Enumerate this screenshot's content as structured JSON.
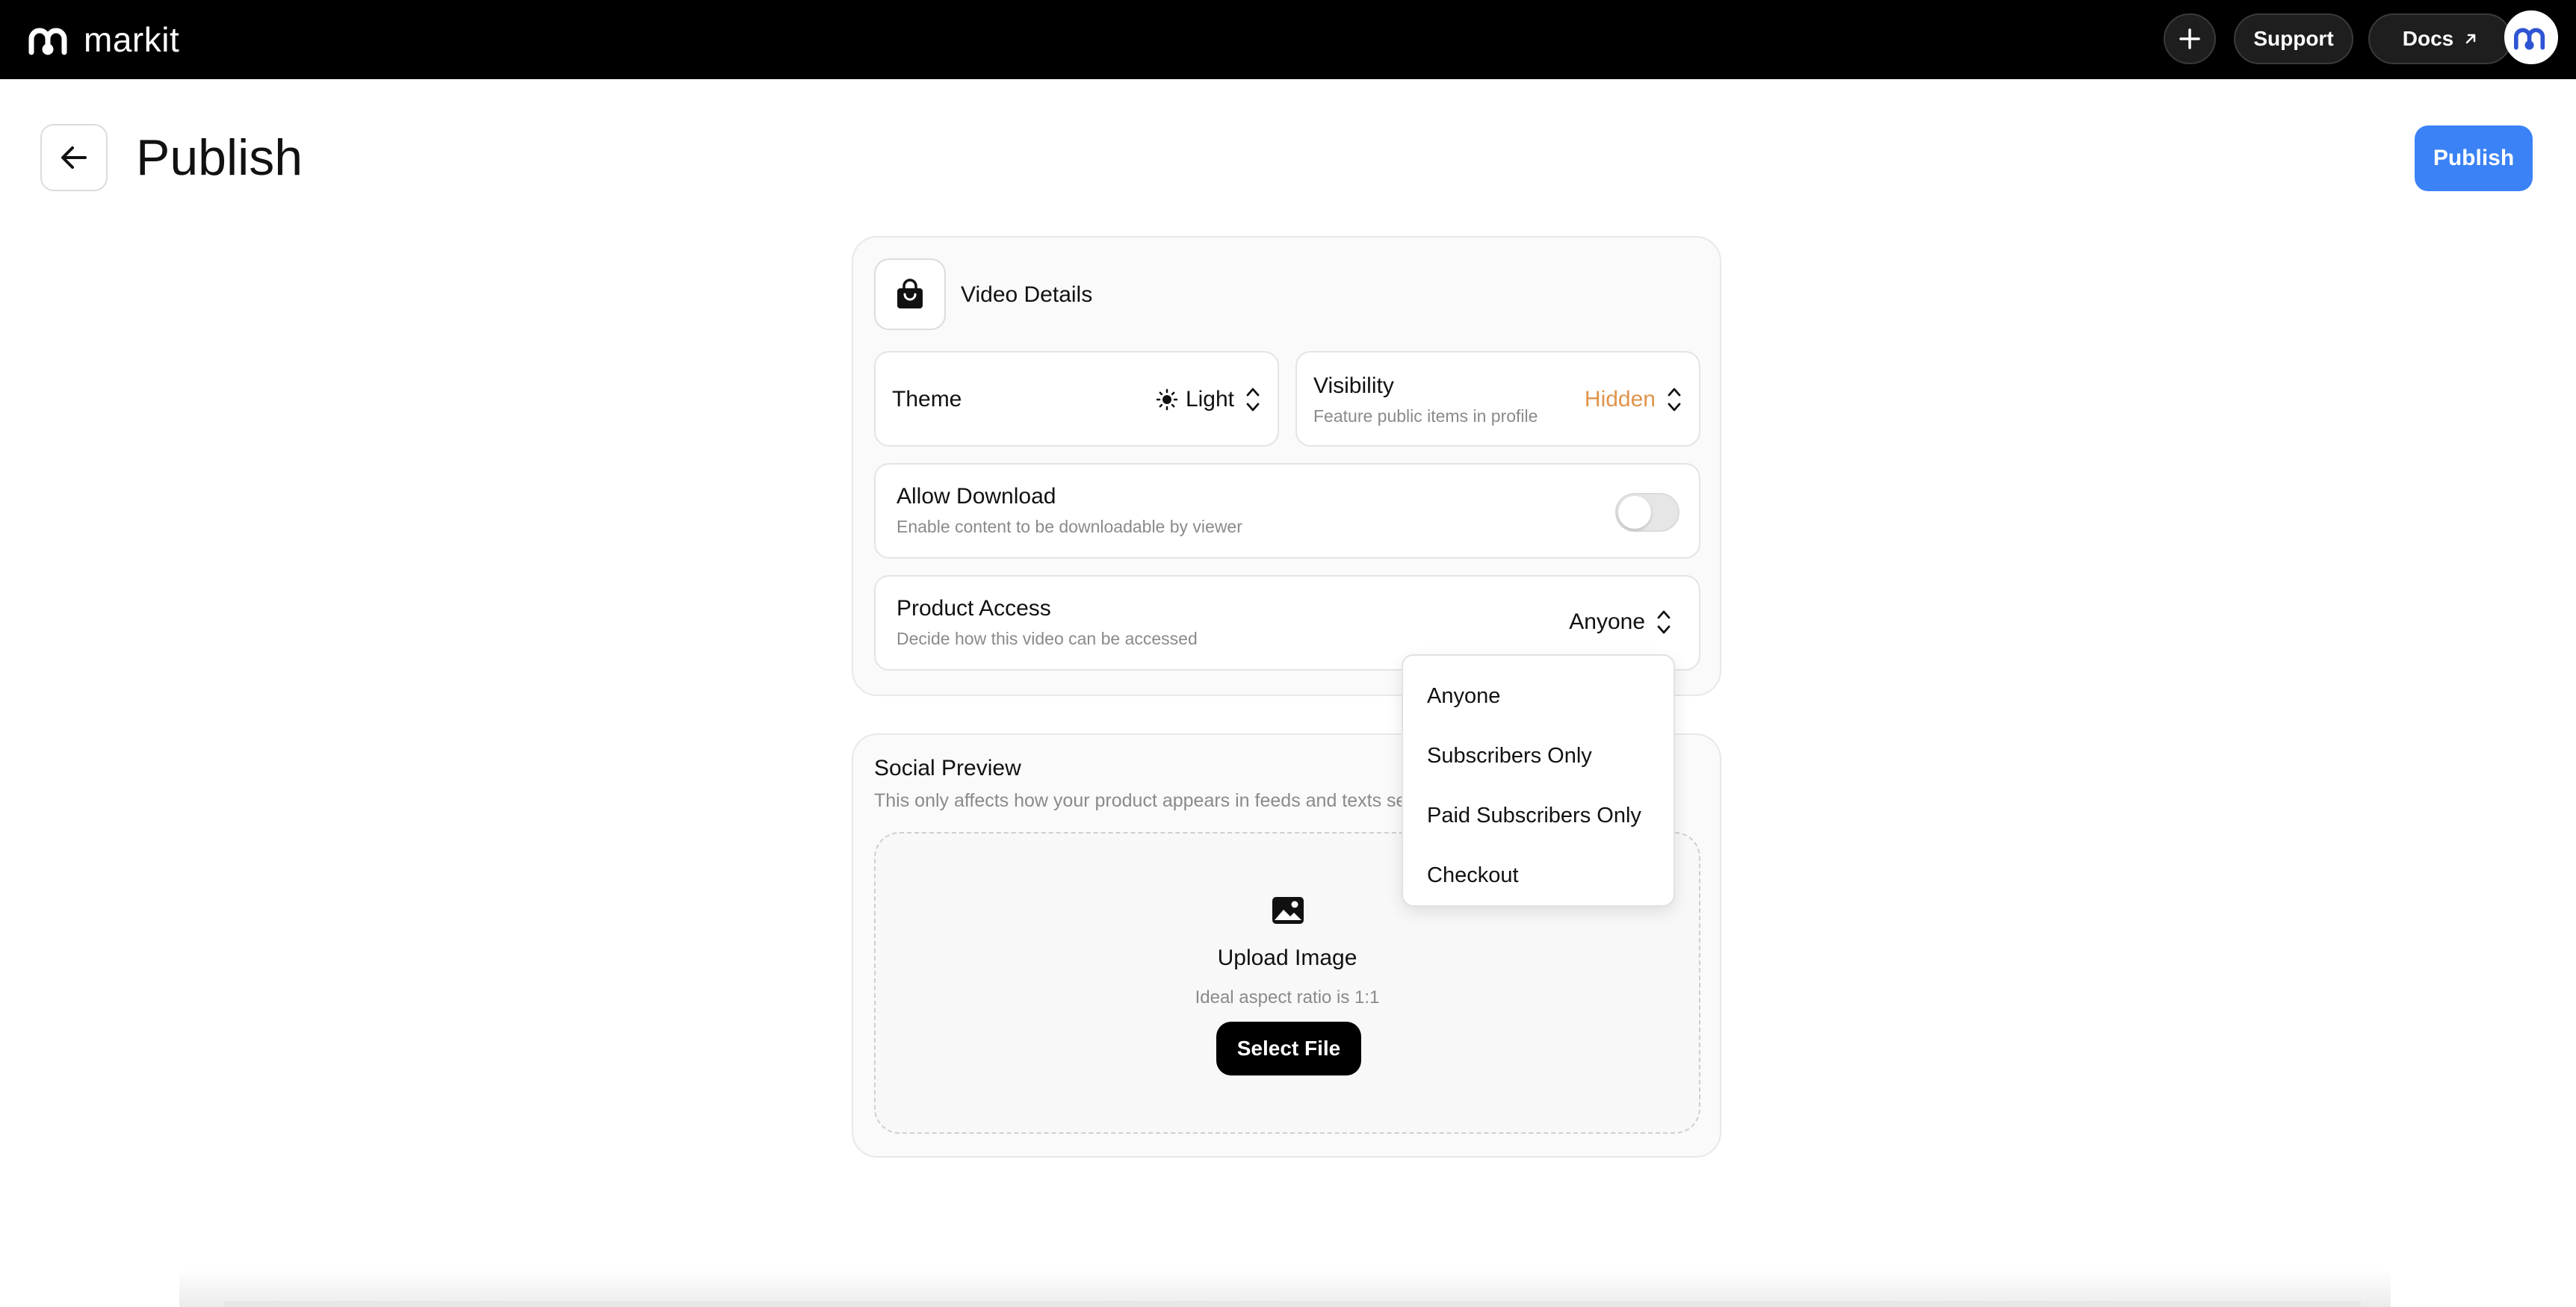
{
  "topbar": {
    "brand": "markit",
    "support_label": "Support",
    "docs_label": "Docs",
    "icons": {
      "logo": "markit-logo-icon",
      "add": "plus-icon",
      "docs_external": "arrow-up-right-icon",
      "avatar": "markit-avatar-icon"
    }
  },
  "header": {
    "title": "Publish",
    "publish_label": "Publish",
    "back_icon": "arrow-left-icon"
  },
  "video_details": {
    "title": "Video Details",
    "icon": "shopping-bag-icon",
    "theme": {
      "label": "Theme",
      "value": "Light",
      "icon": "sun-icon"
    },
    "visibility": {
      "label": "Visibility",
      "sublabel": "Feature public items in profile",
      "value": "Hidden"
    },
    "allow_download": {
      "label": "Allow Download",
      "sublabel": "Enable content to be downloadable by viewer",
      "enabled": false
    },
    "product_access": {
      "label": "Product Access",
      "sublabel": "Decide how this video can be accessed",
      "value": "Anyone"
    }
  },
  "access_dropdown": {
    "options": [
      "Anyone",
      "Subscribers Only",
      "Paid Subscribers Only",
      "Checkout"
    ]
  },
  "social_preview": {
    "title": "Social Preview",
    "sublabel": "This only affects how your product appears in feeds and texts sent",
    "upload_title": "Upload Image",
    "upload_hint": "Ideal aspect ratio is 1:1",
    "select_file_label": "Select File",
    "upload_icon": "image-icon"
  },
  "colors": {
    "accent": "#3b82f6",
    "hidden_value": "#e0944a",
    "topbar": "#000000"
  }
}
